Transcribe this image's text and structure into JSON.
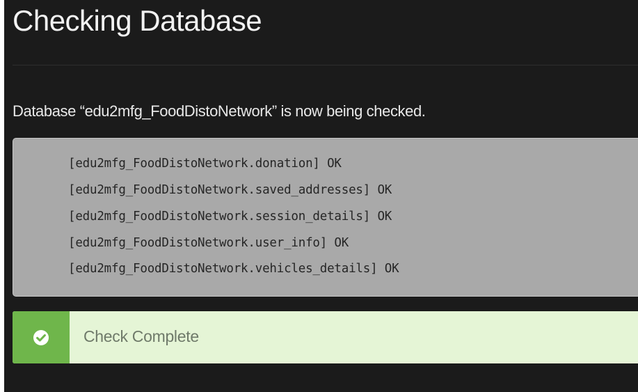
{
  "page": {
    "title": "Checking Database",
    "message": "Database “edu2mfg_FoodDistoNetwork” is now being checked."
  },
  "log": {
    "lines": [
      "[edu2mfg_FoodDistoNetwork.donation] OK",
      "[edu2mfg_FoodDistoNetwork.saved_addresses] OK",
      "[edu2mfg_FoodDistoNetwork.session_details] OK",
      "[edu2mfg_FoodDistoNetwork.user_info] OK",
      "[edu2mfg_FoodDistoNetwork.vehicles_details] OK"
    ]
  },
  "alert": {
    "icon": "check-circle-icon",
    "text": "Check Complete"
  },
  "colors": {
    "background": "#1b1b1b",
    "log_background": "#a9a9a9",
    "success_accent": "#6fb64b",
    "success_background": "#e5f5d6"
  }
}
